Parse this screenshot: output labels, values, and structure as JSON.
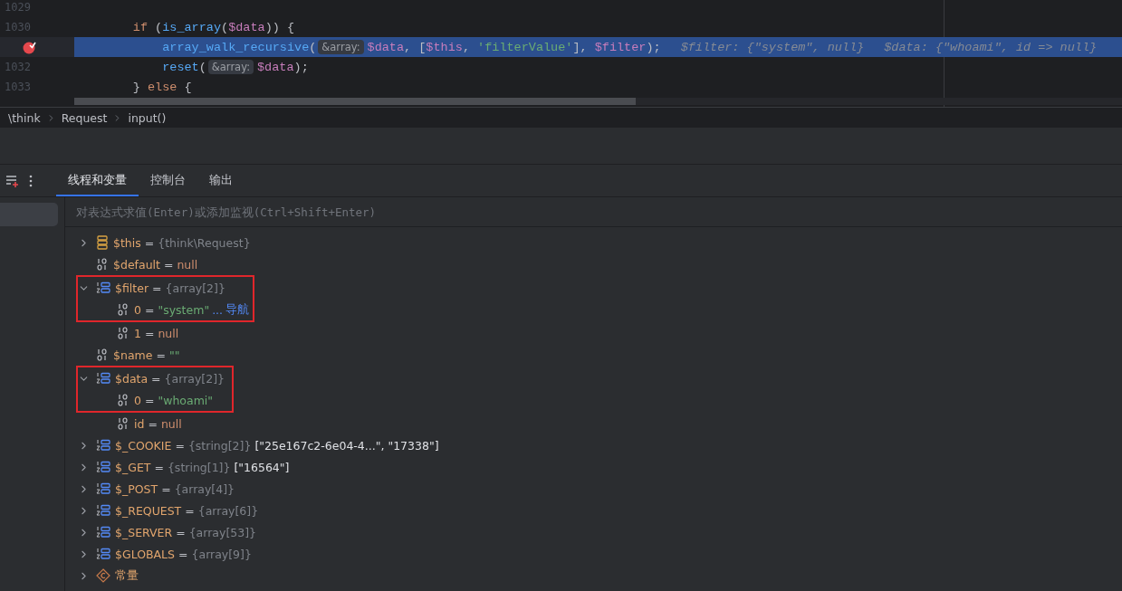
{
  "editor": {
    "lines": [
      {
        "number": "1029",
        "breakpoint": false,
        "current": false
      },
      {
        "number": "1030",
        "breakpoint": false,
        "current": false,
        "tokens": [
          {
            "kind": "keyword",
            "text": "        if"
          },
          {
            "kind": "punct",
            "text": " ("
          },
          {
            "kind": "func",
            "text": "is_array"
          },
          {
            "kind": "punct",
            "text": "("
          },
          {
            "kind": "var",
            "text": "$data"
          },
          {
            "kind": "punct",
            "text": ")) {"
          }
        ]
      },
      {
        "breakpoint": true,
        "current": true,
        "tokens": [
          {
            "kind": "func",
            "text": "            array_walk_recursive"
          },
          {
            "kind": "punct",
            "text": "("
          },
          {
            "kind": "hint",
            "text": "&array:"
          },
          {
            "kind": "var",
            "text": "$data"
          },
          {
            "kind": "punct",
            "text": ", ["
          },
          {
            "kind": "var",
            "text": "$this"
          },
          {
            "kind": "punct",
            "text": ", "
          },
          {
            "kind": "string",
            "text": "'filterValue'"
          },
          {
            "kind": "punct",
            "text": "], "
          },
          {
            "kind": "var",
            "text": "$filter"
          },
          {
            "kind": "punct",
            "text": ");"
          },
          {
            "kind": "inline",
            "text": "$filter: {\"system\", null}"
          },
          {
            "kind": "inline",
            "text": "$data: {\"whoami\", id => null}"
          }
        ]
      },
      {
        "number": "1032",
        "breakpoint": false,
        "current": false,
        "tokens": [
          {
            "kind": "func",
            "text": "            reset"
          },
          {
            "kind": "punct",
            "text": "("
          },
          {
            "kind": "hint",
            "text": "&array:"
          },
          {
            "kind": "var",
            "text": "$data"
          },
          {
            "kind": "punct",
            "text": ");"
          }
        ]
      },
      {
        "number": "1033",
        "breakpoint": false,
        "current": false,
        "tokens": [
          {
            "kind": "punct",
            "text": "        } "
          },
          {
            "kind": "keyword",
            "text": "else"
          },
          {
            "kind": "punct",
            "text": " {"
          }
        ]
      }
    ]
  },
  "breadcrumbs": [
    "\\think",
    "Request",
    "input()"
  ],
  "debug": {
    "tabs": [
      {
        "label": "线程和变量",
        "selected": true
      },
      {
        "label": "控制台",
        "selected": false
      },
      {
        "label": "输出",
        "selected": false
      }
    ],
    "eval_field": {
      "placeholder": "对表达式求值(Enter)或添加监视(Ctrl+Shift+Enter)"
    },
    "variables": [
      {
        "kind": "object",
        "name": "$this",
        "sign": "=",
        "type": "{think\\Request}",
        "expanded": false,
        "boxed": false
      },
      {
        "kind": "scalar",
        "name": "$default",
        "sign": "=",
        "value": {
          "kind": "null",
          "text": "null"
        },
        "boxed": false
      },
      {
        "kind": "array",
        "name": "$filter",
        "sign": "=",
        "type": "{array[2]}",
        "expanded": true,
        "boxed": true,
        "children": [
          {
            "kind": "scalar",
            "name": "0",
            "sign": "=",
            "value": {
              "kind": "string",
              "text": "\"system\""
            },
            "more": "...",
            "link": "导航",
            "boxed": true
          },
          {
            "kind": "scalar",
            "name": "1",
            "sign": "=",
            "value": {
              "kind": "null",
              "text": "null"
            },
            "boxed": false
          }
        ]
      },
      {
        "kind": "scalar",
        "name": "$name",
        "sign": "=",
        "value": {
          "kind": "string",
          "text": "\"\""
        },
        "boxed": false
      },
      {
        "kind": "array",
        "name": "$data",
        "sign": "=",
        "type": "{array[2]}",
        "expanded": true,
        "boxed": true,
        "children": [
          {
            "kind": "scalar",
            "name": "0",
            "sign": "=",
            "value": {
              "kind": "string",
              "text": "\"whoami\""
            },
            "boxed": true
          },
          {
            "kind": "scalar",
            "name": "id",
            "sign": "=",
            "value": {
              "kind": "null",
              "text": "null"
            },
            "boxed": false
          }
        ]
      },
      {
        "kind": "array",
        "name": "$_COOKIE",
        "sign": "=",
        "type": "{string[2]}",
        "value": {
          "kind": "plain",
          "text": "[\"25e167c2-6e04-4...\", \"17338\"]"
        },
        "expanded": false,
        "boxed": false
      },
      {
        "kind": "array",
        "name": "$_GET",
        "sign": "=",
        "type": "{string[1]}",
        "value": {
          "kind": "plain",
          "text": "[\"16564\"]"
        },
        "expanded": false,
        "boxed": false
      },
      {
        "kind": "array",
        "name": "$_POST",
        "sign": "=",
        "type": "{array[4]}",
        "expanded": false,
        "boxed": false
      },
      {
        "kind": "array",
        "name": "$_REQUEST",
        "sign": "=",
        "type": "{array[6]}",
        "expanded": false,
        "boxed": false
      },
      {
        "kind": "array",
        "name": "$_SERVER",
        "sign": "=",
        "type": "{array[53]}",
        "expanded": false,
        "boxed": false
      },
      {
        "kind": "array",
        "name": "$GLOBALS",
        "sign": "=",
        "type": "{array[9]}",
        "expanded": false,
        "boxed": false
      },
      {
        "kind": "constant",
        "name": "常量",
        "expanded": false,
        "boxed": false
      }
    ]
  }
}
